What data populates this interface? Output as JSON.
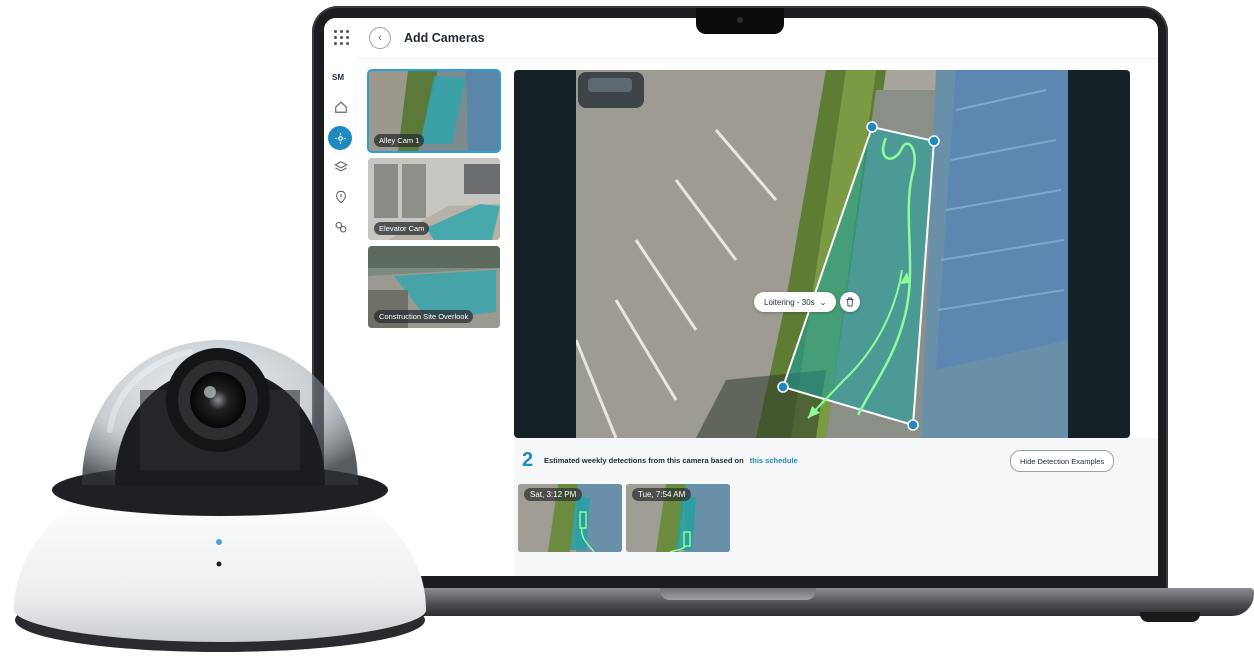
{
  "app": {
    "title": "Add Cameras",
    "user_initials": "SM"
  },
  "sidebar": {
    "icons": [
      "home-icon",
      "cameras-icon",
      "layers-icon",
      "alerts-icon",
      "integrations-icon"
    ],
    "active": "cameras-icon"
  },
  "cameras": [
    {
      "name": "Alley Cam 1",
      "selected": true
    },
    {
      "name": "Elevator Cam",
      "selected": false
    },
    {
      "name": "Construction Site Overlook",
      "selected": false
    }
  ],
  "zone": {
    "rule_label": "Loitering - 30s"
  },
  "detections": {
    "count": "2",
    "text": "Estimated weekly detections from this camera based on",
    "link": "this schedule",
    "hide_button": "Hide Detection Examples",
    "examples": [
      {
        "time": "Sat, 3:12 PM"
      },
      {
        "time": "Tue, 7:54 AM"
      }
    ]
  },
  "colors": {
    "accent": "#1f8ac0",
    "zone_fill": "#1aa3a3",
    "path": "#8dfc9a"
  }
}
